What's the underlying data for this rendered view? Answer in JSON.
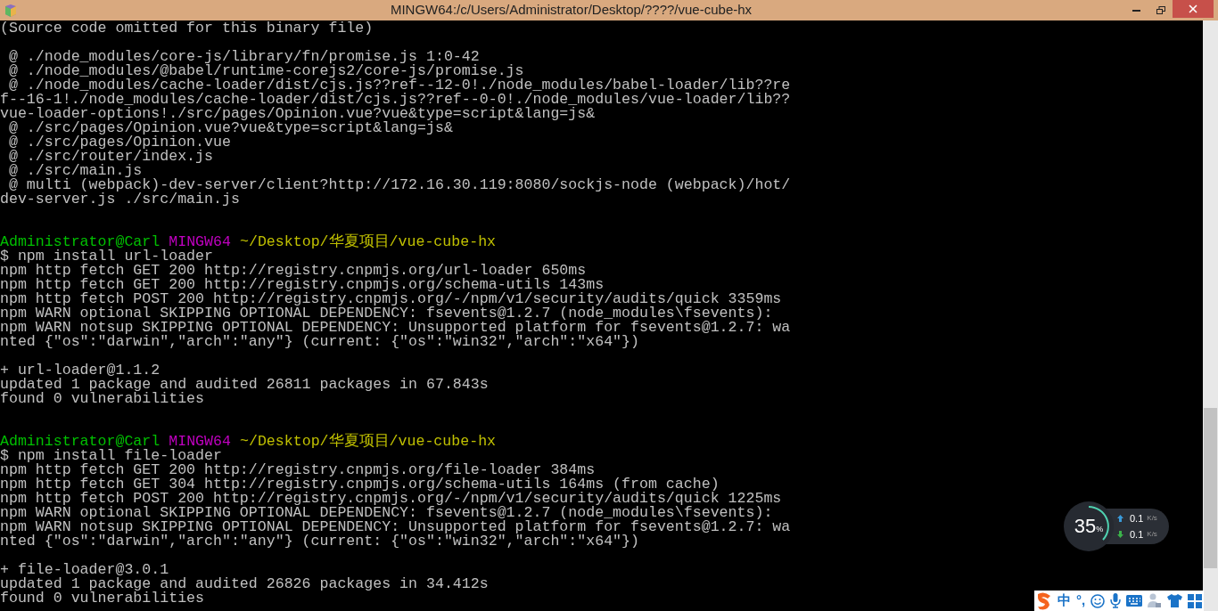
{
  "window": {
    "title": "MINGW64:/c/Users/Administrator/Desktop/????/vue-cube-hx"
  },
  "terminal": {
    "lines": [
      {
        "kind": "text",
        "text": "(Source code omitted for this binary file)"
      },
      {
        "kind": "blank"
      },
      {
        "kind": "text",
        "text": " @ ./node_modules/core-js/library/fn/promise.js 1:0-42"
      },
      {
        "kind": "text",
        "text": " @ ./node_modules/@babel/runtime-corejs2/core-js/promise.js"
      },
      {
        "kind": "text",
        "text": " @ ./node_modules/cache-loader/dist/cjs.js??ref--12-0!./node_modules/babel-loader/lib??re"
      },
      {
        "kind": "text",
        "text": "f--16-1!./node_modules/cache-loader/dist/cjs.js??ref--0-0!./node_modules/vue-loader/lib??"
      },
      {
        "kind": "text",
        "text": "vue-loader-options!./src/pages/Opinion.vue?vue&type=script&lang=js&"
      },
      {
        "kind": "text",
        "text": " @ ./src/pages/Opinion.vue?vue&type=script&lang=js&"
      },
      {
        "kind": "text",
        "text": " @ ./src/pages/Opinion.vue"
      },
      {
        "kind": "text",
        "text": " @ ./src/router/index.js"
      },
      {
        "kind": "text",
        "text": " @ ./src/main.js"
      },
      {
        "kind": "text",
        "text": " @ multi (webpack)-dev-server/client?http://172.16.30.119:8080/sockjs-node (webpack)/hot/"
      },
      {
        "kind": "text",
        "text": "dev-server.js ./src/main.js"
      },
      {
        "kind": "blank"
      },
      {
        "kind": "blank"
      },
      {
        "kind": "prompt",
        "user": "Administrator@Carl",
        "host": "MINGW64",
        "path": "~/Desktop/华夏项目/vue-cube-hx"
      },
      {
        "kind": "text",
        "text": "$ npm install url-loader"
      },
      {
        "kind": "text",
        "text": "npm http fetch GET 200 http://registry.cnpmjs.org/url-loader 650ms"
      },
      {
        "kind": "text",
        "text": "npm http fetch GET 200 http://registry.cnpmjs.org/schema-utils 143ms"
      },
      {
        "kind": "text",
        "text": "npm http fetch POST 200 http://registry.cnpmjs.org/-/npm/v1/security/audits/quick 3359ms"
      },
      {
        "kind": "text",
        "text": "npm WARN optional SKIPPING OPTIONAL DEPENDENCY: fsevents@1.2.7 (node_modules\\fsevents):"
      },
      {
        "kind": "text",
        "text": "npm WARN notsup SKIPPING OPTIONAL DEPENDENCY: Unsupported platform for fsevents@1.2.7: wa"
      },
      {
        "kind": "text",
        "text": "nted {\"os\":\"darwin\",\"arch\":\"any\"} (current: {\"os\":\"win32\",\"arch\":\"x64\"})"
      },
      {
        "kind": "blank"
      },
      {
        "kind": "text",
        "text": "+ url-loader@1.1.2"
      },
      {
        "kind": "text",
        "text": "updated 1 package and audited 26811 packages in 67.843s"
      },
      {
        "kind": "text",
        "text": "found 0 vulnerabilities"
      },
      {
        "kind": "blank"
      },
      {
        "kind": "blank"
      },
      {
        "kind": "prompt",
        "user": "Administrator@Carl",
        "host": "MINGW64",
        "path": "~/Desktop/华夏项目/vue-cube-hx"
      },
      {
        "kind": "text",
        "text": "$ npm install file-loader"
      },
      {
        "kind": "text",
        "text": "npm http fetch GET 200 http://registry.cnpmjs.org/file-loader 384ms"
      },
      {
        "kind": "text",
        "text": "npm http fetch GET 304 http://registry.cnpmjs.org/schema-utils 164ms (from cache)"
      },
      {
        "kind": "text",
        "text": "npm http fetch POST 200 http://registry.cnpmjs.org/-/npm/v1/security/audits/quick 1225ms"
      },
      {
        "kind": "text",
        "text": "npm WARN optional SKIPPING OPTIONAL DEPENDENCY: fsevents@1.2.7 (node_modules\\fsevents):"
      },
      {
        "kind": "text",
        "text": "npm WARN notsup SKIPPING OPTIONAL DEPENDENCY: Unsupported platform for fsevents@1.2.7: wa"
      },
      {
        "kind": "text",
        "text": "nted {\"os\":\"darwin\",\"arch\":\"any\"} (current: {\"os\":\"win32\",\"arch\":\"x64\"})"
      },
      {
        "kind": "blank"
      },
      {
        "kind": "text",
        "text": "+ file-loader@3.0.1"
      },
      {
        "kind": "text",
        "text": "updated 1 package and audited 26826 packages in 34.412s"
      },
      {
        "kind": "text",
        "text": "found 0 vulnerabilities"
      }
    ]
  },
  "speed_widget": {
    "percent": "35",
    "percent_sign": "%",
    "upload": "0.1",
    "upload_unit": "K/s",
    "download": "0.1",
    "download_unit": "K/s"
  },
  "ime_toolbar": {
    "language": "中",
    "punctuation": "°,"
  }
}
